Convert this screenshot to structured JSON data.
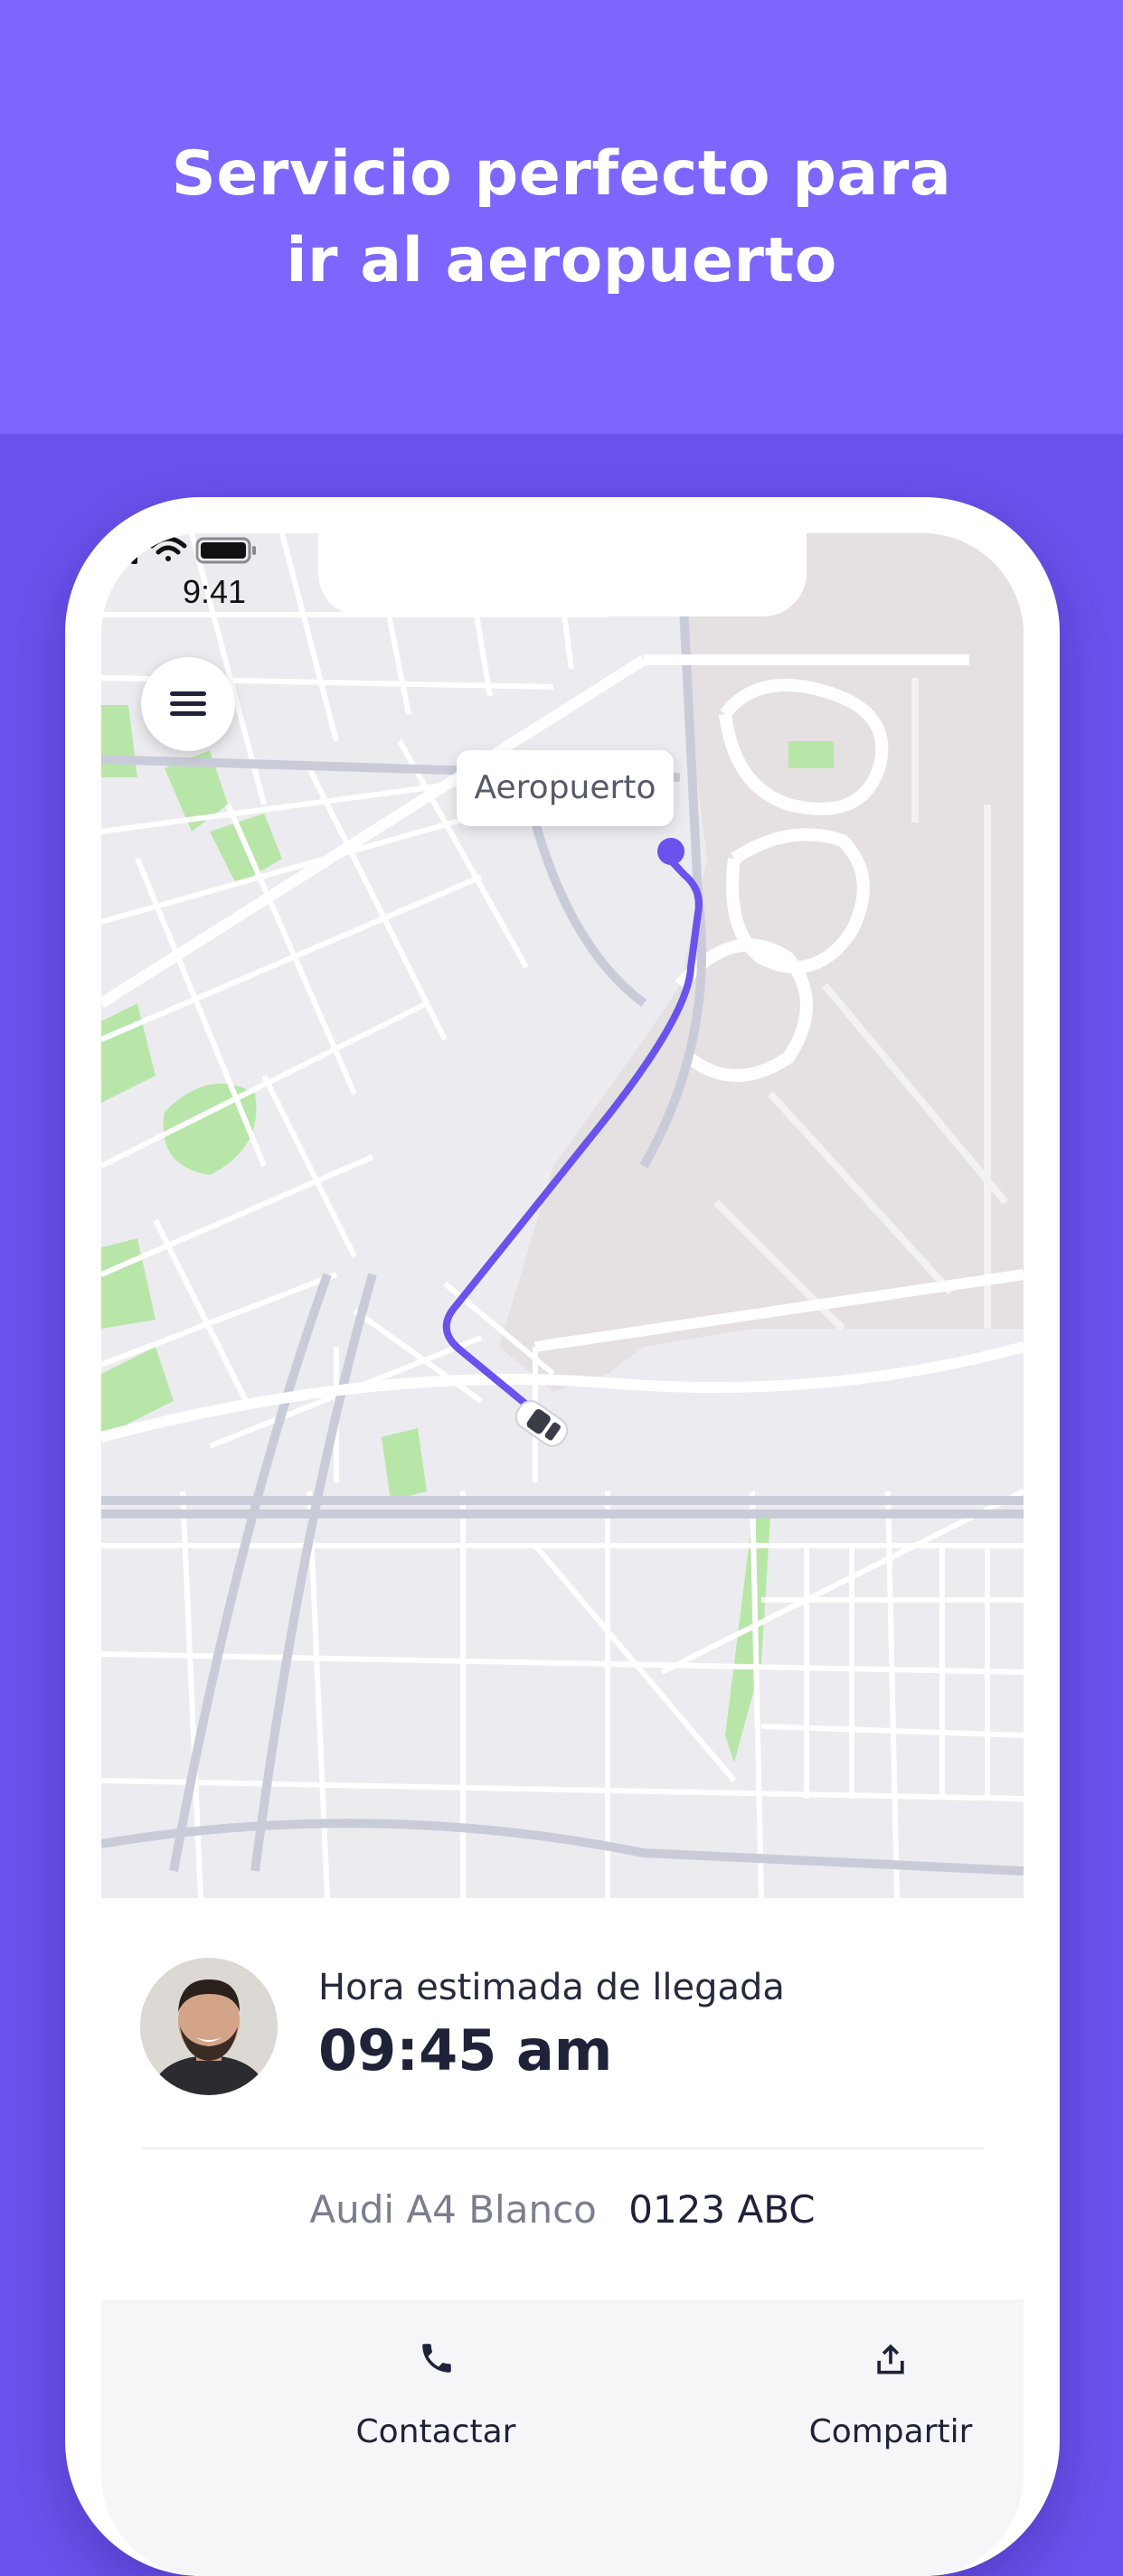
{
  "headline": {
    "line1": "Servicio perfecto para",
    "line2": "ir al aeropuerto"
  },
  "status_bar": {
    "time": "9:41"
  },
  "map": {
    "destination_label": "Aeropuerto",
    "route_color": "#6a52ec"
  },
  "trip": {
    "eta_label": "Hora estimada de llegada",
    "eta_time": "09:45 am",
    "vehicle_model": "Audi A4 Blanco",
    "vehicle_plate": "0123 ABC"
  },
  "actions": [
    {
      "label": "Contactar",
      "icon": "phone-icon"
    },
    {
      "label": "Compartir",
      "icon": "share-icon"
    }
  ],
  "colors": {
    "background": "#6a52ec",
    "hero": "#7c66fd",
    "map_park": "#b8e6a8",
    "map_airport": "#e5e0e2"
  }
}
